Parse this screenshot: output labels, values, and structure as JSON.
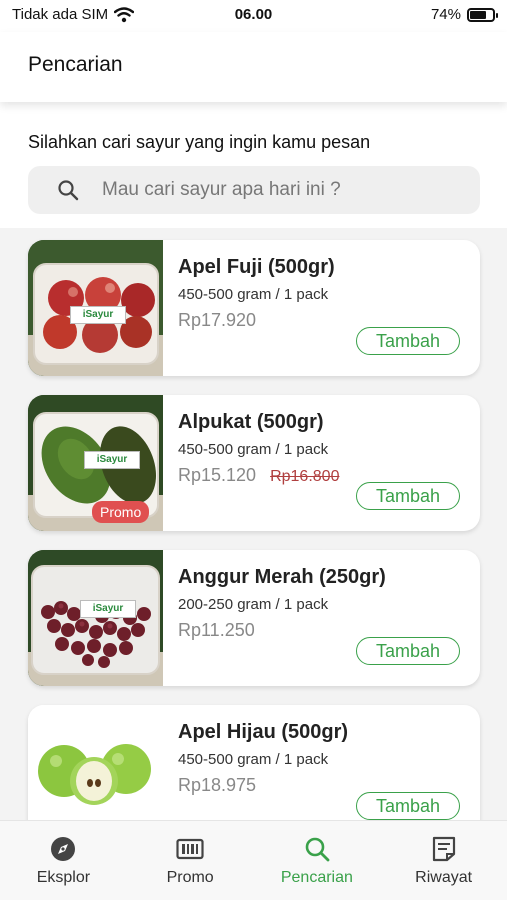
{
  "status_bar": {
    "carrier": "Tidak ada SIM",
    "time": "06.00",
    "battery": "74%",
    "battery_level": 0.74
  },
  "header": {
    "title": "Pencarian"
  },
  "search": {
    "prompt": "Silahkan cari sayur yang ingin kamu pesan",
    "placeholder": "Mau cari sayur apa hari ini ?",
    "value": ""
  },
  "products": [
    {
      "name": "Apel Fuji (500gr)",
      "pack": "450-500 gram / 1 pack",
      "price": "Rp17.920",
      "old_price": "",
      "promo": "",
      "button": "Tambah"
    },
    {
      "name": "Alpukat (500gr)",
      "pack": "450-500 gram / 1 pack",
      "price": "Rp15.120",
      "old_price": "Rp16.800",
      "promo": "Promo",
      "button": "Tambah"
    },
    {
      "name": "Anggur Merah (250gr)",
      "pack": "200-250 gram / 1 pack",
      "price": "Rp11.250",
      "old_price": "",
      "promo": "",
      "button": "Tambah"
    },
    {
      "name": "Apel Hijau (500gr)",
      "pack": "450-500 gram / 1 pack",
      "price": "Rp18.975",
      "old_price": "",
      "promo": "",
      "button": "Tambah"
    }
  ],
  "brand_tag": "iSayur",
  "nav": {
    "items": [
      {
        "label": "Eksplor",
        "icon": "compass-icon",
        "active": false
      },
      {
        "label": "Promo",
        "icon": "promo-icon",
        "active": false
      },
      {
        "label": "Pencarian",
        "icon": "search-icon",
        "active": true
      },
      {
        "label": "Riwayat",
        "icon": "history-icon",
        "active": false
      }
    ]
  },
  "colors": {
    "accent": "#3aa14a",
    "promo": "#e05050",
    "price": "#888888",
    "strike": "#b04040"
  }
}
